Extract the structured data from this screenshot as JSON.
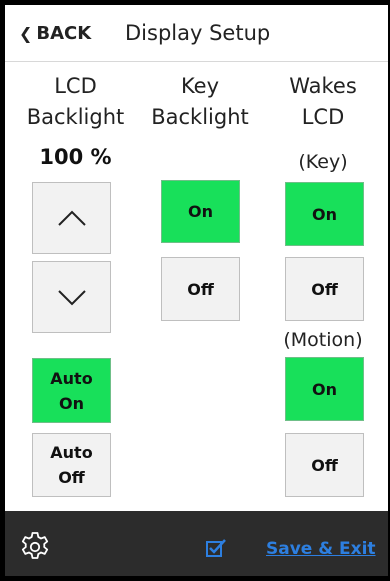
{
  "header": {
    "back_label": "BACK",
    "back_icon": "chevron-left-icon",
    "title": "Display Setup"
  },
  "columns": {
    "lcd_backlight": {
      "heading_line1": "LCD",
      "heading_line2": "Backlight",
      "brightness": "100 %",
      "up_icon": "chevron-up-icon",
      "down_icon": "chevron-down-icon",
      "auto_on_line1": "Auto",
      "auto_on_line2": "On",
      "auto_off_line1": "Auto",
      "auto_off_line2": "Off",
      "auto_selected": "Auto On"
    },
    "key_backlight": {
      "heading_line1": "Key",
      "heading_line2": "Backlight",
      "on_label": "On",
      "off_label": "Off",
      "selected": "On"
    },
    "wakes_lcd": {
      "heading_line1": "Wakes",
      "heading_line2": "LCD",
      "key_label": "(Key)",
      "key_on_label": "On",
      "key_off_label": "Off",
      "key_selected": "On",
      "motion_label": "(Motion)",
      "motion_on_label": "On",
      "motion_off_label": "Off",
      "motion_selected": "On"
    }
  },
  "footer": {
    "settings_icon": "gear-icon",
    "check_icon": "checkbox-checked-icon",
    "save_exit_label": "Save & Exit"
  },
  "colors": {
    "selected_green": "#18e05a",
    "unselected_gray": "#f2f2f2",
    "footer_bg": "#2c2c2c",
    "link_blue": "#2d7fe0"
  }
}
